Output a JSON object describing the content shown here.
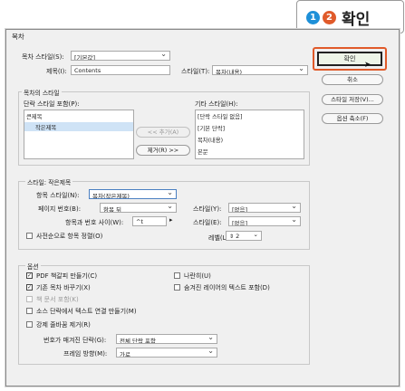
{
  "callout": {
    "step1": "1",
    "step2": "2",
    "label": "확인",
    "colors": {
      "step1": "#1e90d8",
      "step2": "#e05a2a"
    }
  },
  "dialog": {
    "title": "목차",
    "toc_style_label": "목차 스타일(S):",
    "toc_style_value": "[기본값]",
    "title_label": "제목(I):",
    "title_value": "Contents",
    "style_label": "스타일(T):",
    "style_value": "목차(내용)",
    "group_toc_styles": "목차의 스타일",
    "include_label": "단락 스타일 포함(P):",
    "include_items": [
      "큰제목",
      "작은제목"
    ],
    "other_label": "기타 스타일(H):",
    "other_items": [
      "[단락 스타일 없음]",
      "[기본 단락]",
      "목차(내용)",
      "본문"
    ],
    "add_button": "<< 추가(A)",
    "remove_button": "제거(R) >>",
    "group_style_title": "스타일: 작은제목",
    "entry_style_label": "항목 스타일(N):",
    "entry_style_value": "목차(작은제목)",
    "page_number_label": "페이지 번호(B):",
    "page_number_value": "항목 뒤",
    "page_style_label": "스타일(Y):",
    "page_style_value": "[없음]",
    "between_label": "항목과 번호 사이(W):",
    "between_value": "^t",
    "between_style_label": "스타일(E):",
    "between_style_value": "[없음]",
    "sort_label": "사전순으로 항목 정렬(O)",
    "level_label": "레벨(L):",
    "level_value": "2",
    "options_title": "옵션",
    "opt_pdf": "PDF 책갈피 만들기(C)",
    "opt_replace": "기존 목차 바꾸기(X)",
    "opt_book": "책 문서 포함(K)",
    "opt_source": "소스 단락에서 텍스트 연결 만들기(M)",
    "opt_linebreak": "강제 줄바꿈 제거(R)",
    "opt_runin": "나란히(U)",
    "opt_hidden": "숨겨진 레이어의 텍스트 포함(D)",
    "numbered_label": "번호가 매겨진 단락(G):",
    "numbered_value": "전체 단락 포함",
    "frame_label": "프레임 방향(M):",
    "frame_value": "가로",
    "ok_button": "확인",
    "cancel_button": "취소",
    "save_style_button": "스타일 저장(V)...",
    "fewer_options_button": "옵션 축소(F)"
  }
}
